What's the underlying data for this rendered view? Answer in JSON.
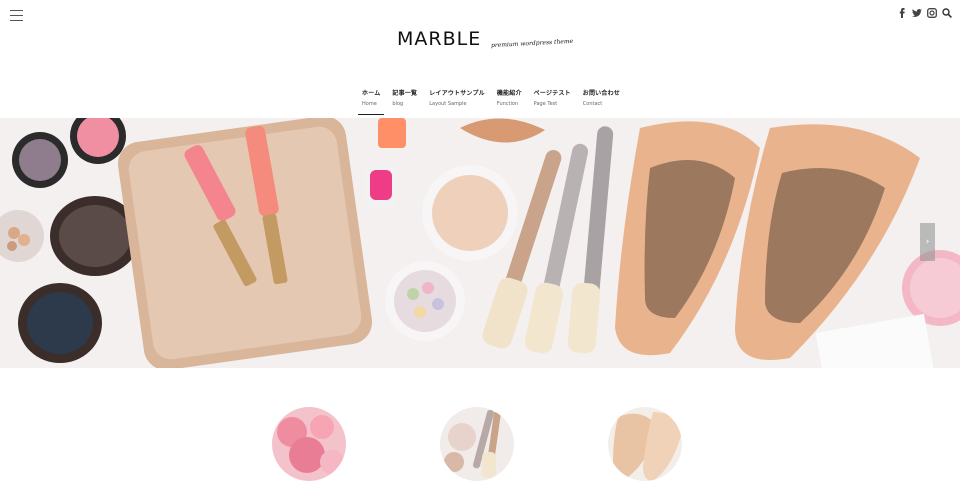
{
  "header": {
    "logo_text": "MARBLE",
    "tagline": "premium wordpress theme",
    "menu_icon": "hamburger-menu-icon",
    "social_icons": [
      "facebook-icon",
      "twitter-icon",
      "instagram-icon",
      "search-icon"
    ]
  },
  "nav": {
    "items": [
      {
        "jp": "ホーム",
        "en": "Home",
        "active": true
      },
      {
        "jp": "記事一覧",
        "en": "blog",
        "active": false
      },
      {
        "jp": "レイアウトサンプル",
        "en": "Layout Sample",
        "active": false
      },
      {
        "jp": "機能紹介",
        "en": "Function",
        "active": false
      },
      {
        "jp": "ページテスト",
        "en": "Page Test",
        "active": false
      },
      {
        "jp": "お問い合わせ",
        "en": "Contact",
        "active": false
      }
    ]
  },
  "hero": {
    "image": "cosmetics-flatlay-photo",
    "next_arrow": "›"
  },
  "features": [
    {
      "image": "pink-roses-photo"
    },
    {
      "image": "makeup-brushes-photo"
    },
    {
      "image": "nude-heels-photo"
    }
  ],
  "colors": {
    "accent": "#222222",
    "hero_bg": "#f4f1f0"
  }
}
